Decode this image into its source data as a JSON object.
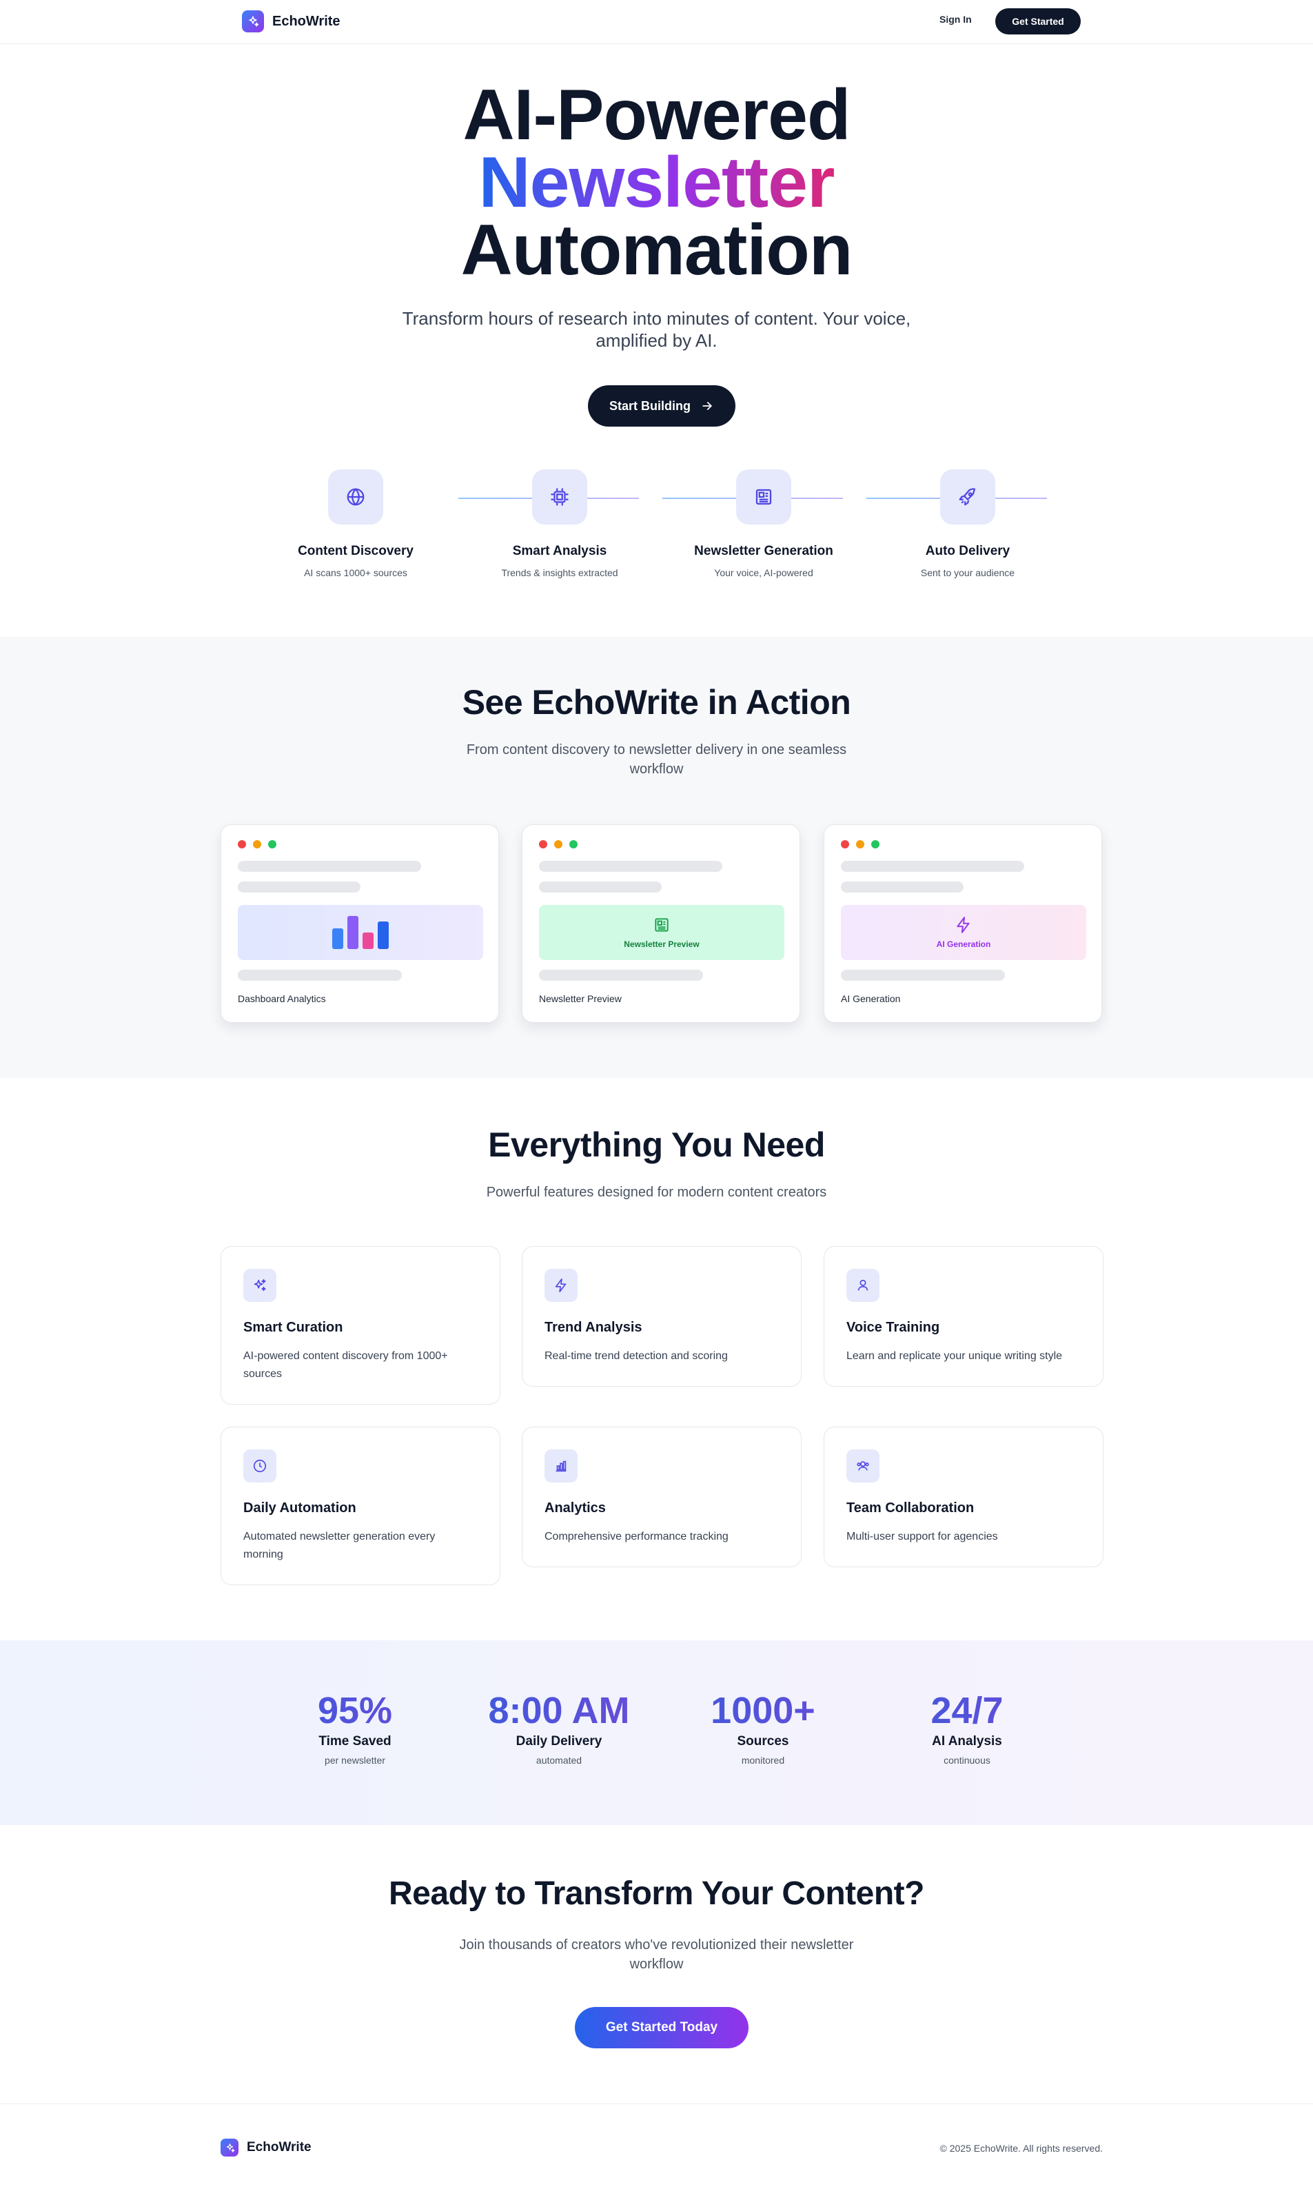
{
  "nav": {
    "brand": "EchoWrite",
    "sign_in": "Sign In",
    "get_started": "Get Started"
  },
  "hero": {
    "title_line1": "AI-Powered",
    "title_line2": "Newsletter",
    "title_line3": "Automation",
    "subtitle": "Transform hours of research into minutes of content. Your voice, amplified by AI.",
    "cta": "Start Building"
  },
  "steps": [
    {
      "icon": "globe-icon",
      "title": "Content Discovery",
      "desc": "AI scans 1000+ sources"
    },
    {
      "icon": "cpu-icon",
      "title": "Smart Analysis",
      "desc": "Trends & insights extracted"
    },
    {
      "icon": "newspaper-icon",
      "title": "Newsletter Generation",
      "desc": "Your voice, AI-powered"
    },
    {
      "icon": "rocket-icon",
      "title": "Auto Delivery",
      "desc": "Sent to your audience"
    }
  ],
  "action": {
    "title": "See EchoWrite in Action",
    "subtitle": "From content discovery to newsletter delivery in one seamless workflow",
    "cards": [
      {
        "label": "Dashboard Analytics",
        "panel_text": ""
      },
      {
        "label": "Newsletter Preview",
        "panel_text": "Newsletter Preview"
      },
      {
        "label": "AI Generation",
        "panel_text": "AI Generation"
      }
    ]
  },
  "features": {
    "title": "Everything You Need",
    "subtitle": "Powerful features designed for modern content creators",
    "items": [
      {
        "icon": "sparkles-icon",
        "title": "Smart Curation",
        "desc": "AI-powered content discovery from 1000+ sources"
      },
      {
        "icon": "zap-icon",
        "title": "Trend Analysis",
        "desc": "Real-time trend detection and scoring"
      },
      {
        "icon": "user-icon",
        "title": "Voice Training",
        "desc": "Learn and replicate your unique writing style"
      },
      {
        "icon": "clock-icon",
        "title": "Daily Automation",
        "desc": "Automated newsletter generation every morning"
      },
      {
        "icon": "bar-chart-icon",
        "title": "Analytics",
        "desc": "Comprehensive performance tracking"
      },
      {
        "icon": "users-icon",
        "title": "Team Collaboration",
        "desc": "Multi-user support for agencies"
      }
    ]
  },
  "stats": [
    {
      "value": "95%",
      "label": "Time Saved",
      "sub": "per newsletter"
    },
    {
      "value": "8:00 AM",
      "label": "Daily Delivery",
      "sub": "automated"
    },
    {
      "value": "1000+",
      "label": "Sources",
      "sub": "monitored"
    },
    {
      "value": "24/7",
      "label": "AI Analysis",
      "sub": "continuous"
    }
  ],
  "cta": {
    "title": "Ready to Transform Your Content?",
    "subtitle": "Join thousands of creators who've revolutionized their newsletter workflow",
    "button": "Get Started Today"
  },
  "footer": {
    "brand": "EchoWrite",
    "copyright": "© 2025 EchoWrite. All rights reserved."
  },
  "colors": {
    "dark": "#0f172a",
    "accent_blue": "#2563eb",
    "accent_purple": "#9333ea",
    "accent_pink": "#db2777",
    "icon_bg": "#e5e9fb"
  }
}
